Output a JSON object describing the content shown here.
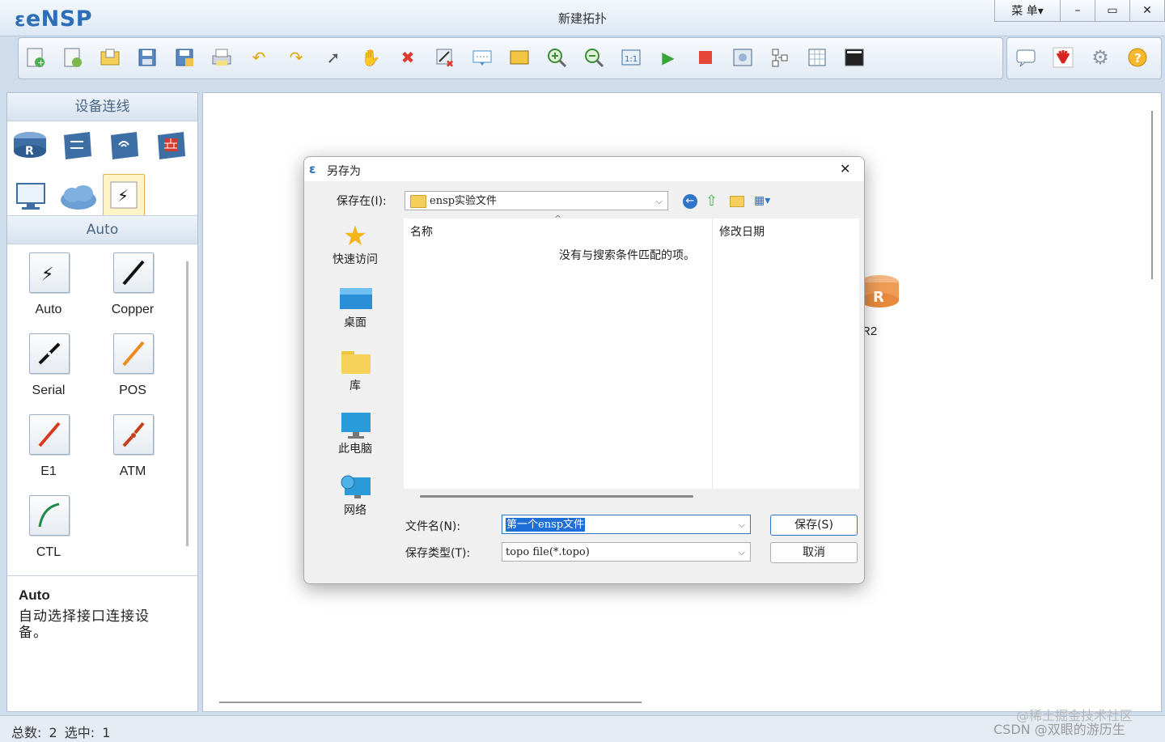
{
  "app": {
    "logo_text": "eNSP",
    "window_title": "新建拓扑"
  },
  "window_controls": {
    "menu_label": "菜 单▾",
    "minimize": "–",
    "maximize": "▭",
    "close": "✕"
  },
  "toolbar": {
    "icons": [
      "new-topology-icon",
      "new-lab-icon",
      "open-icon",
      "save-icon",
      "save-as-icon",
      "print-icon",
      "undo-icon",
      "redo-icon",
      "select-pointer-icon",
      "pan-hand-icon",
      "delete-icon",
      "delete-links-icon",
      "text-label-icon",
      "rectangle-icon",
      "zoom-in-icon",
      "zoom-out-icon",
      "fit-view-icon",
      "start-device-icon",
      "stop-device-icon",
      "capture-icon",
      "topology-icon",
      "grid-icon",
      "terminal-icon"
    ],
    "right_icons": [
      "chat-icon",
      "huawei-icon",
      "settings-icon",
      "help-icon"
    ]
  },
  "left_panel": {
    "device_header": "设备连线",
    "category_label": "Auto",
    "device_icons": [
      "router-icon",
      "switch-icon",
      "wireless-icon",
      "firewall-icon",
      "pc-icon",
      "cloud-icon",
      "auto-link-icon"
    ],
    "cables": [
      {
        "label": "Auto",
        "color": "#222222"
      },
      {
        "label": "Copper",
        "color": "#111111"
      },
      {
        "label": "Serial",
        "color": "#111111"
      },
      {
        "label": "POS",
        "color": "#f08a1e"
      },
      {
        "label": "E1",
        "color": "#d73a1e"
      },
      {
        "label": "ATM",
        "color": "#c8401a"
      },
      {
        "label": "CTL",
        "color": "#1f8a4a"
      }
    ],
    "description_title": "Auto",
    "description_text": "自动选择接口连接设备。"
  },
  "canvas": {
    "device_label": "R2",
    "device_letter": "R"
  },
  "status": {
    "text": "总数: 2 选中: 1"
  },
  "watermark": {
    "line1": "@稀土掘金技术社区",
    "line2": "CSDN @双眼的游历生"
  },
  "dialog": {
    "title": "另存为",
    "close": "✕",
    "save_in_label": "保存在(I):",
    "save_in_value": "ensp实验文件",
    "nav_items": [
      {
        "label": "快速访问",
        "icon": "star-icon"
      },
      {
        "label": "桌面",
        "icon": "desktop-icon"
      },
      {
        "label": "库",
        "icon": "library-folder-icon"
      },
      {
        "label": "此电脑",
        "icon": "this-pc-icon"
      },
      {
        "label": "网络",
        "icon": "network-icon"
      }
    ],
    "columns": {
      "name": "名称",
      "modified": "修改日期"
    },
    "empty_message": "没有与搜索条件匹配的项。",
    "filename_label": "文件名(N):",
    "filename_value": "第一个ensp文件",
    "filetype_label": "保存类型(T):",
    "filetype_value": "topo file(*.topo)",
    "save_button": "保存(S)",
    "cancel_button": "取消"
  }
}
